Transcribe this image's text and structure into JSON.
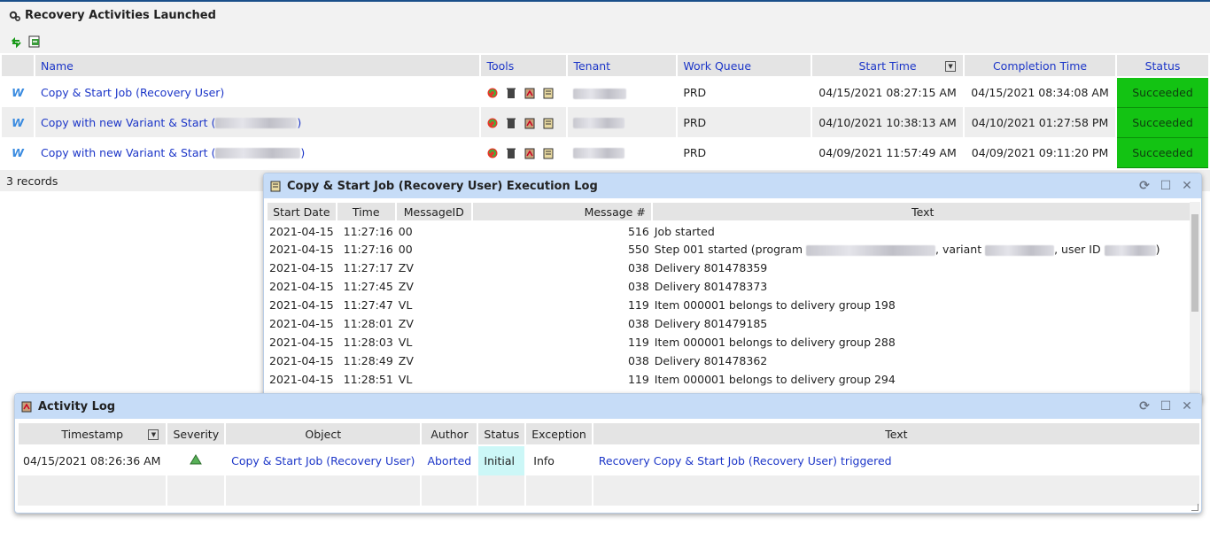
{
  "page": {
    "title": "Recovery Activities Launched"
  },
  "main": {
    "columns": [
      "Name",
      "Tools",
      "Tenant",
      "Work Queue",
      "Start Time",
      "Completion Time",
      "Status"
    ],
    "rows": [
      {
        "name": "Copy & Start Job (Recovery User)",
        "queue": "PRD",
        "start": "04/15/2021 08:27:15 AM",
        "end": "04/15/2021 08:34:08 AM",
        "status": "Succeeded"
      },
      {
        "name": "Copy with new Variant & Start (",
        "name_end": ")",
        "queue": "PRD",
        "start": "04/10/2021 10:38:13 AM",
        "end": "04/10/2021 01:27:58 PM",
        "status": "Succeeded"
      },
      {
        "name": "Copy with new Variant & Start (",
        "name_end": ")",
        "queue": "PRD",
        "start": "04/09/2021 11:57:49 AM",
        "end": "04/09/2021 09:11:20 PM",
        "status": "Succeeded"
      }
    ],
    "records": "3 records",
    "status_color": "#13c313"
  },
  "exec_log": {
    "title": "Copy & Start Job (Recovery User) Execution Log",
    "columns": [
      "Start Date",
      "Time",
      "MessageID",
      "Message #",
      "Text"
    ],
    "rows": [
      {
        "date": "2021-04-15",
        "time": "11:27:16",
        "id": "00",
        "num": "516",
        "text": "Job started"
      },
      {
        "date": "2021-04-15",
        "time": "11:27:16",
        "id": "00",
        "num": "550",
        "text": "Step 001 started (program",
        "text2": ", variant",
        "text3": ", user ID",
        "text4": ")"
      },
      {
        "date": "2021-04-15",
        "time": "11:27:17",
        "id": "ZV",
        "num": "038",
        "text": "Delivery 801478359"
      },
      {
        "date": "2021-04-15",
        "time": "11:27:45",
        "id": "ZV",
        "num": "038",
        "text": "Delivery 801478373"
      },
      {
        "date": "2021-04-15",
        "time": "11:27:47",
        "id": "VL",
        "num": "119",
        "text": "Item 000001 belongs to delivery group 198"
      },
      {
        "date": "2021-04-15",
        "time": "11:28:01",
        "id": "ZV",
        "num": "038",
        "text": "Delivery 801479185"
      },
      {
        "date": "2021-04-15",
        "time": "11:28:03",
        "id": "VL",
        "num": "119",
        "text": "Item 000001 belongs to delivery group 288"
      },
      {
        "date": "2021-04-15",
        "time": "11:28:49",
        "id": "ZV",
        "num": "038",
        "text": "Delivery 801478362"
      },
      {
        "date": "2021-04-15",
        "time": "11:28:51",
        "id": "VL",
        "num": "119",
        "text": "Item 000001 belongs to delivery group 294"
      }
    ]
  },
  "activity_log": {
    "title": "Activity Log",
    "columns": [
      "Timestamp",
      "Severity",
      "Object",
      "Author",
      "Status",
      "Exception",
      "Text"
    ],
    "rows": [
      {
        "timestamp": "04/15/2021 08:26:36 AM",
        "object": "Copy & Start Job (Recovery User)",
        "author": "Aborted",
        "status": "Initial",
        "exception": "Info",
        "text": "Recovery Copy & Start Job (Recovery User) triggered"
      }
    ]
  },
  "icons": {
    "title": "gears-icon",
    "refresh": "refresh-icon",
    "export": "export-icon",
    "row": "workflow-w-icon",
    "tools": [
      "restart-icon",
      "delete-icon",
      "activity-log-icon",
      "execution-log-icon"
    ],
    "win_controls": [
      "refresh-icon",
      "maximize-icon",
      "close-icon"
    ]
  }
}
